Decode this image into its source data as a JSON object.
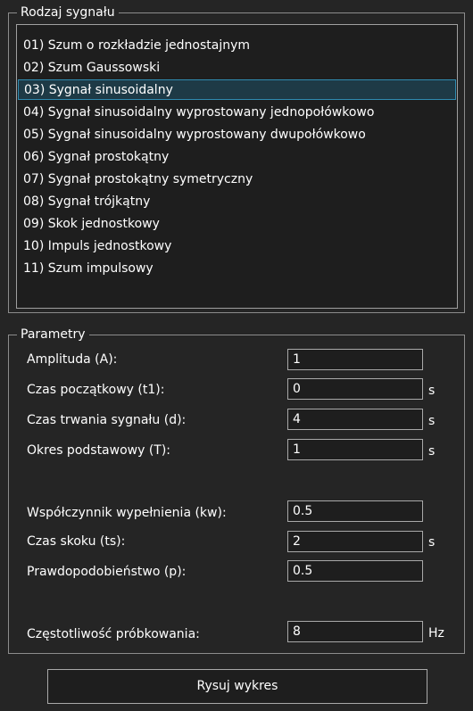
{
  "signal_group": {
    "legend": "Rodzaj sygnału",
    "items": [
      "01) Szum o rozkładzie jednostajnym",
      "02) Szum Gaussowski",
      "03) Sygnał sinusoidalny",
      "04) Sygnał sinusoidalny wyprostowany jednopołówkowo",
      "05) Sygnał sinusoidalny wyprostowany dwupołówkowo",
      "06) Sygnał prostokątny",
      "07) Sygnał prostokątny symetryczny",
      "08) Sygnał trójkątny",
      "09) Skok jednostkowy",
      "10) Impuls jednostkowy",
      "11) Szum impulsowy"
    ],
    "selected": "03) Sygnał sinusoidalny"
  },
  "params": {
    "legend": "Parametry",
    "amplitude": {
      "label": "Amplituda (A):",
      "value": "1"
    },
    "start_time": {
      "label": "Czas początkowy (t1):",
      "value": "0",
      "unit": "s"
    },
    "duration": {
      "label": "Czas trwania sygnału (d):",
      "value": "4",
      "unit": "s"
    },
    "period": {
      "label": "Okres podstawowy (T):",
      "value": "1",
      "unit": "s"
    },
    "duty_cycle": {
      "label": "Współczynnik wypełnienia (kw):",
      "value": "0.5"
    },
    "step_time": {
      "label": "Czas skoku (ts):",
      "value": "2",
      "unit": "s"
    },
    "probability": {
      "label": "Prawdopodobieństwo (p):",
      "value": "0.5"
    },
    "sampling": {
      "label": "Częstotliwość próbkowania:",
      "value": "8",
      "unit": "Hz"
    }
  },
  "draw_button": {
    "label": "Rysuj wykres"
  }
}
